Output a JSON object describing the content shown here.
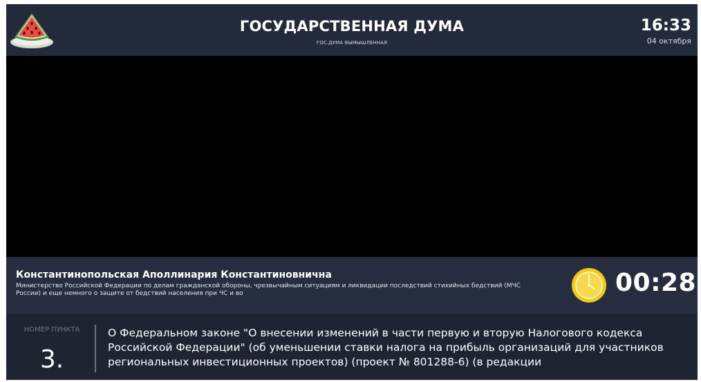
{
  "header": {
    "title": "ГОСУДАРСТВЕННАЯ ДУМА",
    "subtitle": "ГОС.ДУМА ВЫМЫШЛЕННАЯ",
    "time": "16:33",
    "date": "04 октября",
    "logo_icon": "watermelon-logo-icon"
  },
  "speaker": {
    "name": "Константинопольская Аполлинария Константиновнична",
    "role": "Министерство Российской Федерации по делам гражданской обороны, чрезвычайным ситуациям и ликвидации последствий стихийных бедствий (МЧС России) и еще немного о защите от бедствий населения при ЧС и во",
    "timer": "00:28",
    "timer_icon": "clock-icon"
  },
  "agenda": {
    "item_label": "НОМЕР ПУНКТА",
    "item_number": "3.",
    "item_text": "О Федеральном законе \"О внесении изменений в части первую и вторую Налогового кодекса Российской Федерации\" (об уменьшении ставки налога на прибыль организаций для участников региональных инвестиционных проектов) (проект № 801288-6) (в редакции"
  },
  "colors": {
    "background": "#1f2433",
    "header": "#232a3b",
    "speaker_panel": "#262d3e",
    "accent_clock": "#f2c81c",
    "muted_text": "#6c7590"
  }
}
